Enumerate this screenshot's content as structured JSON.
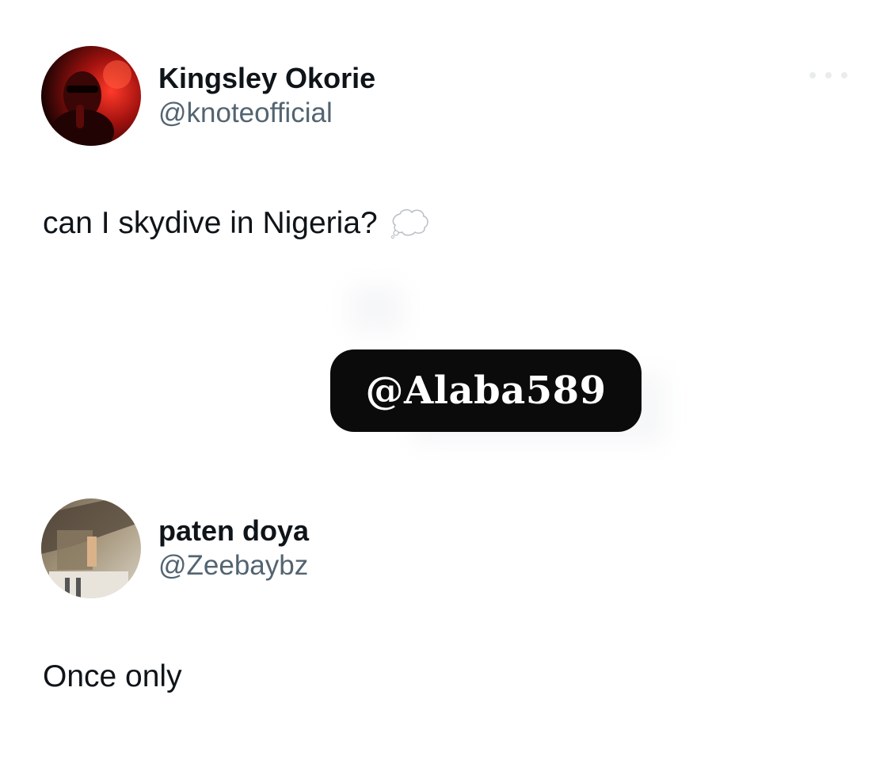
{
  "tweet": {
    "author": {
      "name": "Kingsley Okorie",
      "handle": "@knoteofficial",
      "avatar_icon": "profile-photo-red"
    },
    "text": "can I skydive in Nigeria?",
    "emoji_icon": "thought-balloon-icon"
  },
  "reply": {
    "author": {
      "name": "paten doya",
      "handle": "@Zeebaybz",
      "avatar_icon": "profile-photo-room"
    },
    "text": "Once only"
  },
  "watermark": {
    "text": "@Alaba589",
    "background": "#0b0b0b",
    "color": "#ffffff"
  },
  "colors": {
    "name": "#0f1419",
    "handle": "#536471",
    "background": "#ffffff"
  }
}
